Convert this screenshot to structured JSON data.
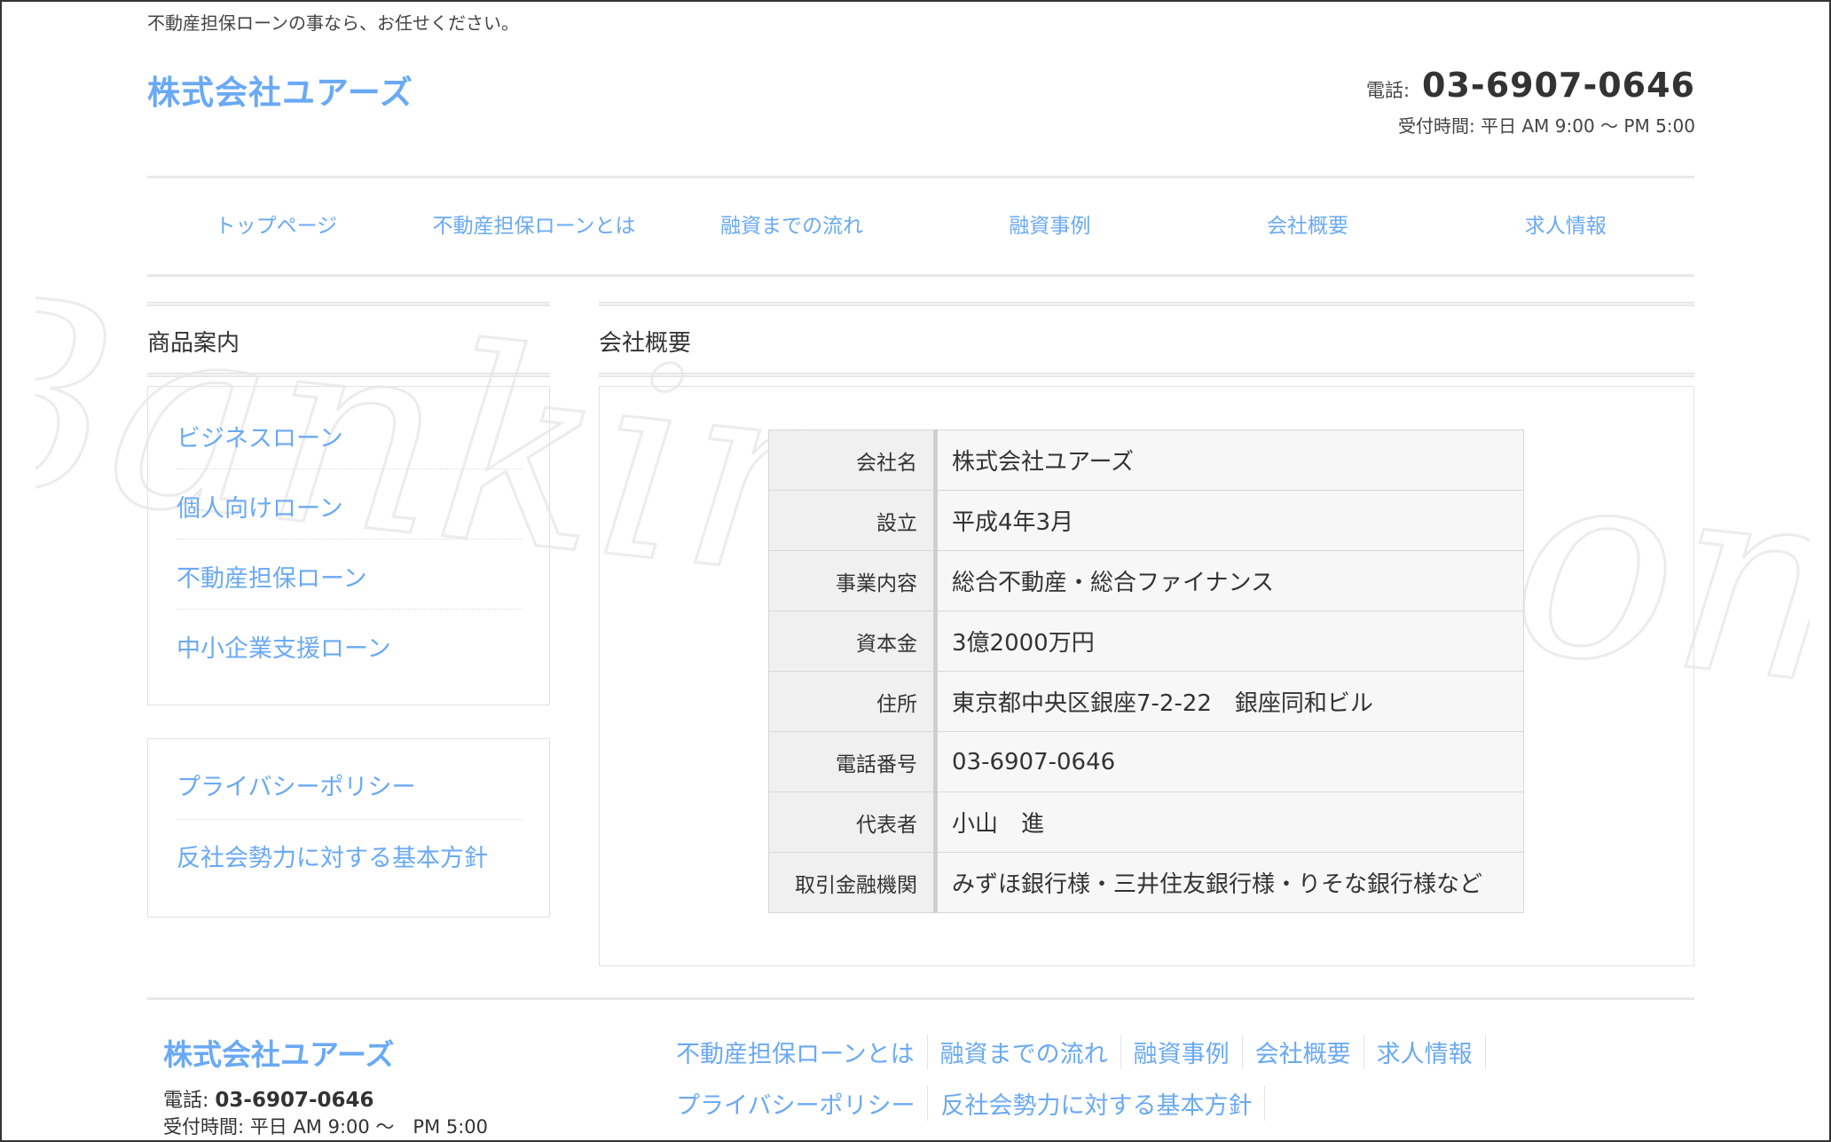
{
  "header": {
    "tagline": "不動産担保ローンの事なら、お任せください。",
    "logo": "株式会社ユアーズ",
    "tel_label": "電話:",
    "tel_number": "03-6907-0646",
    "hours": "受付時間: 平日 AM 9:00 ～ PM 5:00"
  },
  "nav": [
    {
      "label": "トップページ"
    },
    {
      "label": "不動産担保ローンとは"
    },
    {
      "label": "融資までの流れ"
    },
    {
      "label": "融資事例"
    },
    {
      "label": "会社概要"
    },
    {
      "label": "求人情報"
    }
  ],
  "sidebar": {
    "title": "商品案内",
    "products": [
      {
        "label": "ビジネスローン"
      },
      {
        "label": "個人向けローン"
      },
      {
        "label": "不動産担保ローン"
      },
      {
        "label": "中小企業支援ローン"
      }
    ],
    "policies": [
      {
        "label": "プライバシーポリシー"
      },
      {
        "label": "反社会勢力に対する基本方針"
      }
    ]
  },
  "main": {
    "title": "会社概要",
    "rows": [
      {
        "label": "会社名",
        "value": "株式会社ユアーズ"
      },
      {
        "label": "設立",
        "value": "平成4年3月"
      },
      {
        "label": "事業内容",
        "value": "総合不動産・総合ファイナンス"
      },
      {
        "label": "資本金",
        "value": "3億2000万円"
      },
      {
        "label": "住所",
        "value": "東京都中央区銀座7-2-22　銀座同和ビル"
      },
      {
        "label": "電話番号",
        "value": "03-6907-0646"
      },
      {
        "label": "代表者",
        "value": "小山　進"
      },
      {
        "label": "取引金融機関",
        "value": "みずほ銀行様・三井住友銀行様・りそな銀行様など"
      }
    ]
  },
  "footer": {
    "logo": "株式会社ユアーズ",
    "tel_label": "電話:",
    "tel_number": "03-6907-0646",
    "hours": "受付時間: 平日 AM 9:00 ～　PM 5:00",
    "links_row1": [
      {
        "label": "不動産担保ローンとは"
      },
      {
        "label": "融資までの流れ"
      },
      {
        "label": "融資事例"
      },
      {
        "label": "会社概要"
      },
      {
        "label": "求人情報"
      }
    ],
    "links_row2": [
      {
        "label": "プライバシーポリシー"
      },
      {
        "label": "反社会勢力に対する基本方針"
      }
    ]
  },
  "watermark": {
    "text": "Banking-g.com",
    "color": "#ebebeb"
  },
  "colors": {
    "accent": "#6aa9f5",
    "text": "#333333",
    "border": "#e3e3e3"
  }
}
